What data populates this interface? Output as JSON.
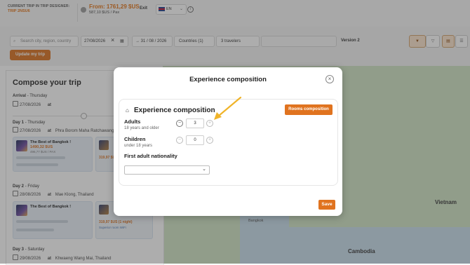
{
  "topbar": {
    "trip_label": "CURRENT TRIP IN TRIP DESIGNER:",
    "trip_name": "TRIP 2NSU6",
    "price_from": "From: 1761,29 $US",
    "price_per_pax": "587,10 $US / Pax",
    "exit_label": "Exit",
    "language": "EN",
    "info_icon": "i"
  },
  "filters": {
    "search_placeholder": "Search city, region, country",
    "start_date": "27/08/2026",
    "end_date": "→ 31 / 08 / 2026",
    "countries": "Countries (1)",
    "travelers": "3 travelers",
    "version": "Version 2",
    "update_button": "Update my trip"
  },
  "panel": {
    "title": "Compose your trip",
    "arrival_label": "Arrival",
    "arrival_day": "- Thursday",
    "arrival_date": "27/08/2026",
    "arrival_at": "at",
    "day1_label": "Day 1",
    "day1_day": "- Thursday",
    "day1_date": "27/08/2026",
    "day1_at": "at",
    "day1_place": "Phra Borom Maha Ratchawang",
    "day1_card_name": "The Best of Bangkok !",
    "day1_card_price": "1490,32 $US",
    "day1_card_price2": "496,77 $US / PAX",
    "day1_card2_price": "319,97 $US",
    "day2_label": "Day 2",
    "day2_day": "- Friday",
    "day2_date": "28/08/2026",
    "day2_at": "at",
    "day2_place": "Mae Klong, Thailand",
    "day2_card_name": "The Best of Bangkok !",
    "day2_card2_price": "319,97 $US (1 night)",
    "day2_card2_note": "Superior room WiFi",
    "day3_label": "Day 3",
    "day3_day": "- Saturday",
    "day3_date": "29/08/2026",
    "day3_at": "at",
    "day3_place": "Khwaeng Wang Mai, Thailand"
  },
  "map": {
    "vietnam": "Vietnam",
    "cambodia": "Cambodia",
    "bangkok": "Bangkok"
  },
  "modal": {
    "title": "Experience composition",
    "section_title": "Experience composition",
    "rooms_button": "Rooms composition",
    "adults_label": "Adults",
    "adults_sub": "18 years and older",
    "adults_value": "3",
    "children_label": "Children",
    "children_sub": "under 18 years",
    "children_value": "0",
    "nationality_label": "First adult nationality",
    "nationality_value": "",
    "save_button": "Save",
    "minus": "−",
    "plus": "+",
    "close": "×"
  },
  "colors": {
    "accent": "#e0731f",
    "arrow": "#f0b429"
  }
}
